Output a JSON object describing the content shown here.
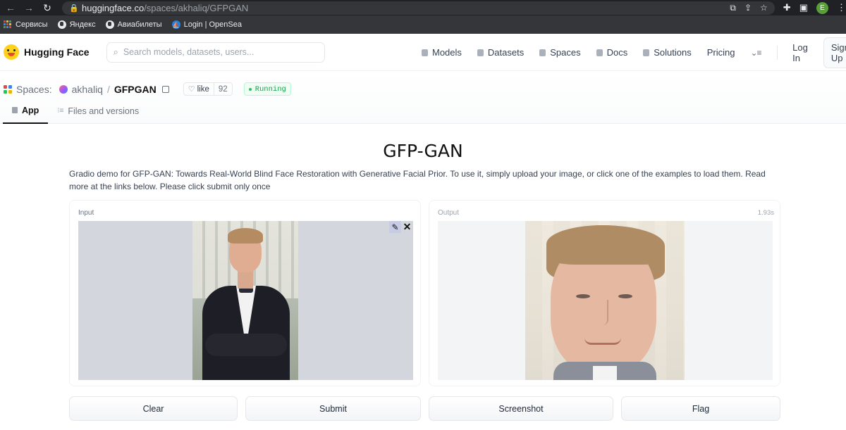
{
  "browser": {
    "url_host": "huggingface.co",
    "url_path": "/spaces/akhaliq/GFPGAN",
    "profile_initial": "E",
    "bookmarks": [
      {
        "label": "Сервисы"
      },
      {
        "label": "Яндекс"
      },
      {
        "label": "Авиабилеты"
      },
      {
        "label": "Login | OpenSea"
      }
    ]
  },
  "hf_header": {
    "logo_text": "Hugging Face",
    "search_placeholder": "Search models, datasets, users...",
    "nav": {
      "models": "Models",
      "datasets": "Datasets",
      "spaces": "Spaces",
      "docs": "Docs",
      "solutions": "Solutions",
      "pricing": "Pricing",
      "login": "Log In",
      "signup": "Sign Up"
    }
  },
  "space": {
    "spaces_label": "Spaces:",
    "owner": "akhaliq",
    "slash": "/",
    "repo": "GFPGAN",
    "like_label": "like",
    "like_count": "92",
    "status": "Running",
    "tabs": {
      "app": "App",
      "files": "Files and versions"
    }
  },
  "app": {
    "title": "GFP-GAN",
    "description": "Gradio demo for GFP-GAN: Towards Real-World Blind Face Restoration with Generative Facial Prior. To use it, simply upload your image, or click one of the examples to load them. Read more at the links below. Please click submit only once",
    "input_label": "Input",
    "output_label": "Output",
    "output_time": "1.93s",
    "buttons": {
      "clear": "Clear",
      "submit": "Submit",
      "screenshot": "Screenshot",
      "flag": "Flag"
    }
  },
  "colors": {
    "chrome_dark": "#202124",
    "bookmarks_bar": "#35363a",
    "running_green": "#16a34a",
    "hf_yellow": "#ffd21e"
  }
}
